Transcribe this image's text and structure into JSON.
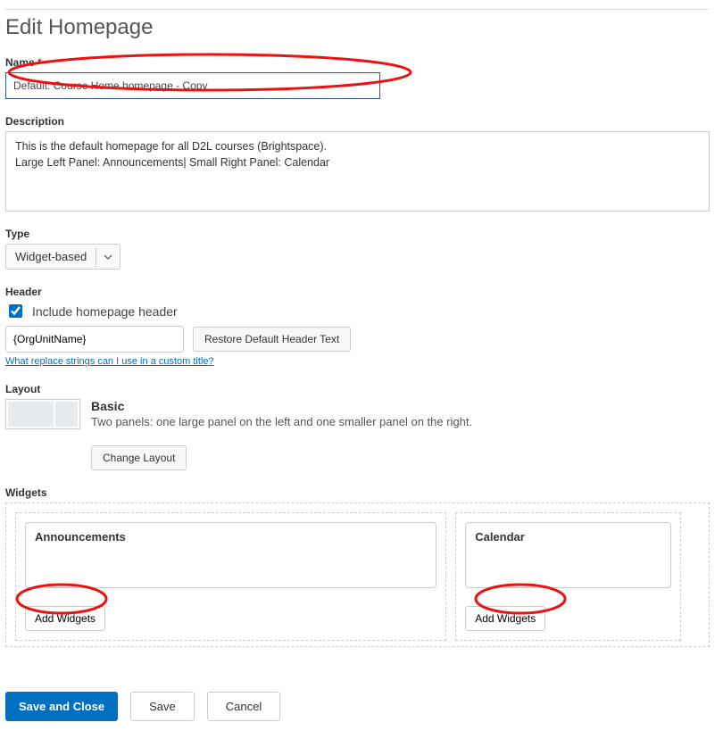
{
  "page": {
    "title": "Edit Homepage"
  },
  "name": {
    "label": "Name",
    "required": "*",
    "value": "Default: Course Home homepage - Copy"
  },
  "description": {
    "label": "Description",
    "value": "This is the default homepage for all D2L courses (Brightspace).\nLarge Left Panel: Announcements| Small Right Panel: Calendar"
  },
  "type": {
    "label": "Type",
    "selected": "Widget-based"
  },
  "header": {
    "label": "Header",
    "checkbox_label": "Include homepage header",
    "checked": true,
    "input_value": "{OrgUnitName}",
    "restore_btn": "Restore Default Header Text",
    "help_link": "What replace strings can I use in a custom title?"
  },
  "layout": {
    "label": "Layout",
    "name": "Basic",
    "desc": "Two panels: one large panel on the left and one smaller panel on the right.",
    "change_btn": "Change Layout"
  },
  "widgets": {
    "label": "Widgets",
    "left": {
      "title": "Announcements",
      "add_btn": "Add Widgets"
    },
    "right": {
      "title": "Calendar",
      "add_btn": "Add Widgets"
    }
  },
  "actions": {
    "save_close": "Save and Close",
    "save": "Save",
    "cancel": "Cancel"
  }
}
